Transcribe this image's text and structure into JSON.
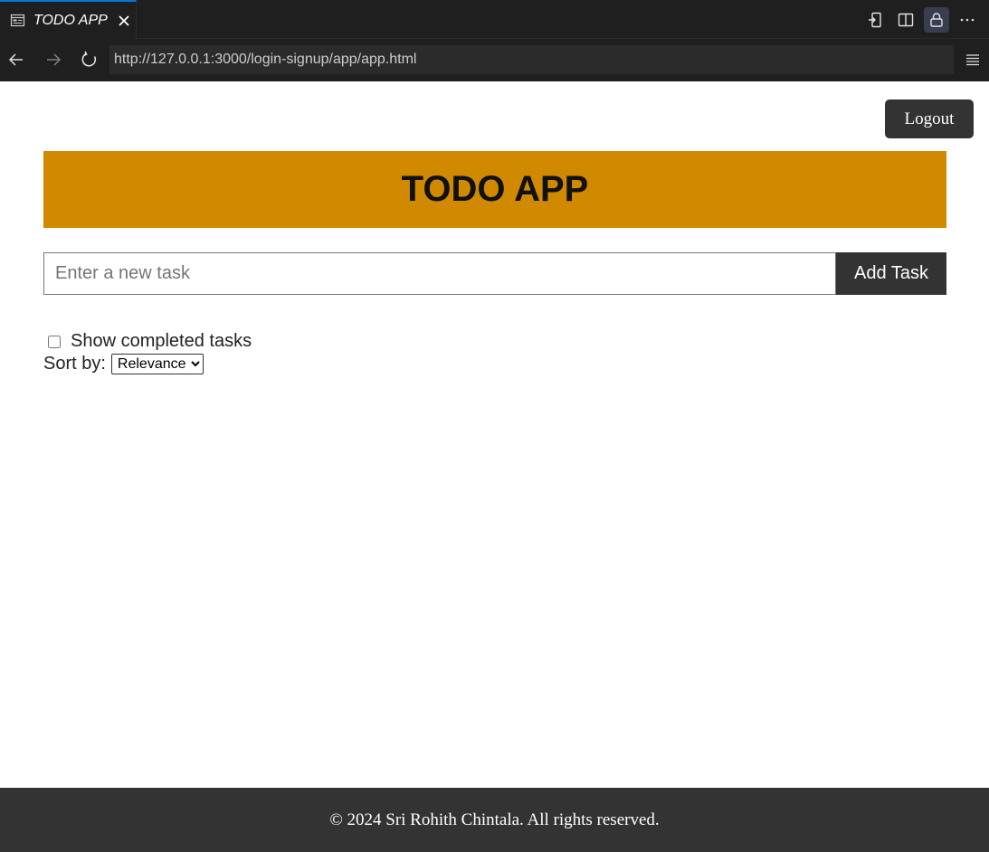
{
  "tab": {
    "title": "TODO APP",
    "icon": "browser-preview-icon",
    "close_icon": "close-icon"
  },
  "tab_actions": [
    {
      "name": "open-in-editor-icon"
    },
    {
      "name": "split-editor-icon"
    },
    {
      "name": "lock-icon"
    },
    {
      "name": "more-actions-icon"
    }
  ],
  "nav": {
    "back_icon": "arrow-left-icon",
    "forward_icon": "arrow-right-icon",
    "reload_icon": "reload-icon",
    "url": "http://127.0.0.1:3000/login-signup/app/app.html",
    "menu_icon": "hamburger-menu-icon"
  },
  "page": {
    "logout_label": "Logout",
    "title": "TODO APP",
    "banner_color": "#d18a00",
    "task_input": {
      "placeholder": "Enter a new task",
      "value": ""
    },
    "add_label": "Add Task",
    "show_completed_label": "Show completed tasks",
    "show_completed_checked": false,
    "sort_label": "Sort by:",
    "sort_selected": "Relevance",
    "footer_text": "© 2024 Sri Rohith Chintala. All rights reserved."
  }
}
